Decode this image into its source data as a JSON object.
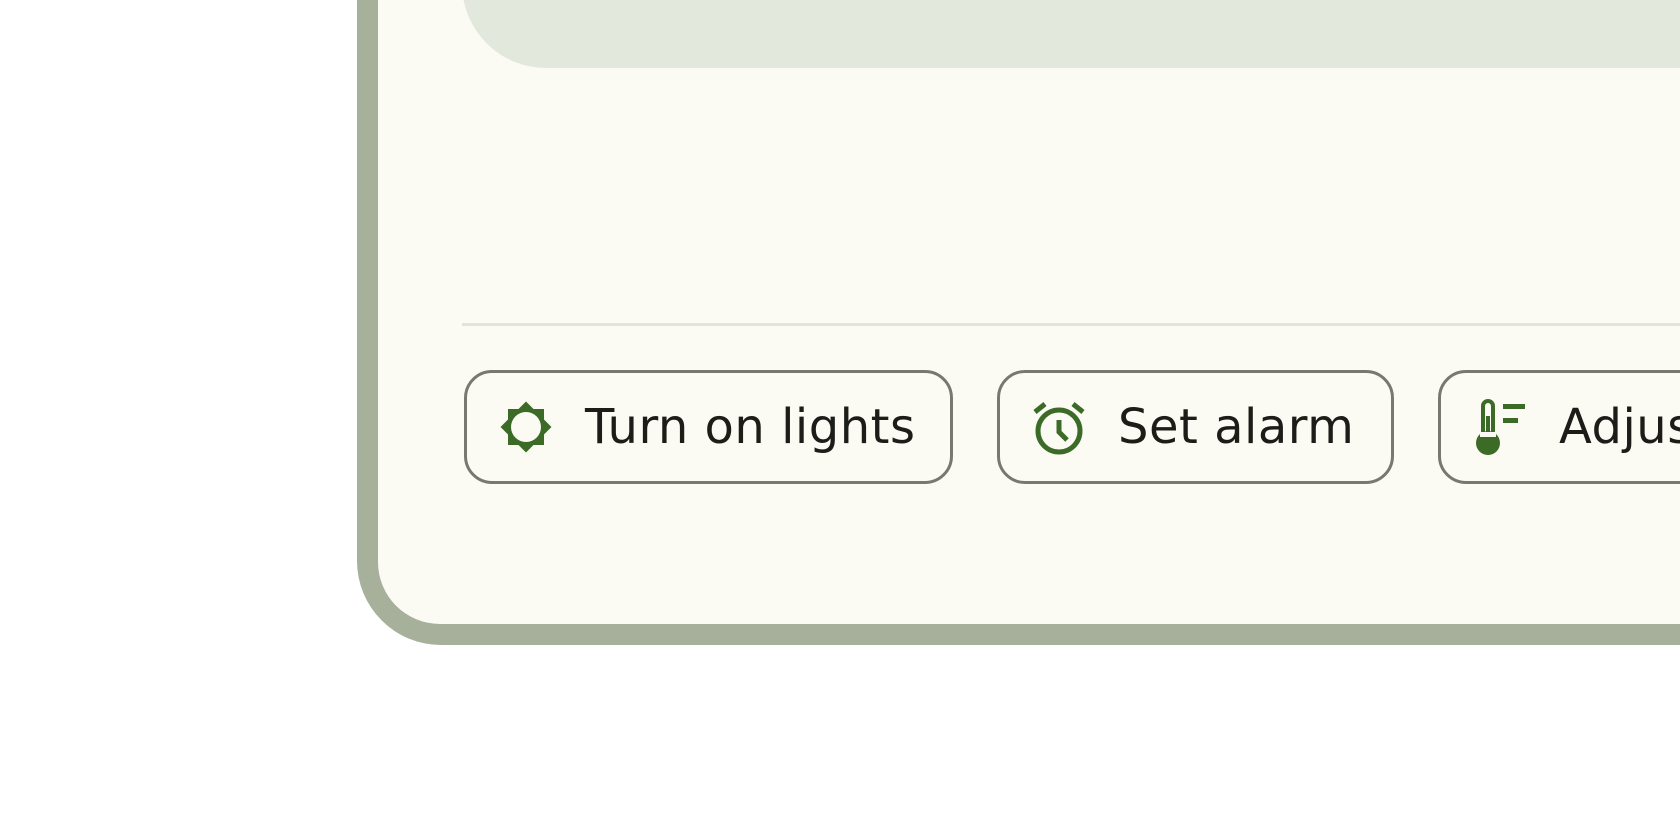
{
  "accent_color": "#3b6b26",
  "suggestions": [
    {
      "label": "Turn on lights",
      "icon": "brightness-icon"
    },
    {
      "label": "Set alarm",
      "icon": "alarm-clock-icon"
    },
    {
      "label": "Adjus",
      "icon": "thermostat-icon"
    }
  ]
}
